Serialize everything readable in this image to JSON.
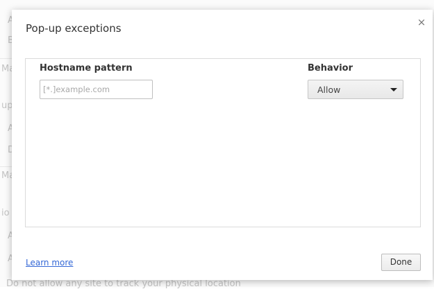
{
  "background": {
    "fragments": [
      "A",
      "B",
      "Ma",
      "up",
      "A",
      "D",
      "Ma",
      "io",
      "A",
      "A"
    ],
    "footer_text": "Do not allow any site to track your physical location"
  },
  "dialog": {
    "title": "Pop-up exceptions",
    "close_icon": "×",
    "columns": {
      "hostname": "Hostname pattern",
      "behavior": "Behavior"
    },
    "new_entry": {
      "hostname_value": "",
      "hostname_placeholder": "[*.]example.com",
      "behavior_selected": "Allow"
    },
    "learn_more": "Learn more",
    "done_label": "Done"
  },
  "colors": {
    "link": "#3367d6",
    "border": "#dadada"
  }
}
